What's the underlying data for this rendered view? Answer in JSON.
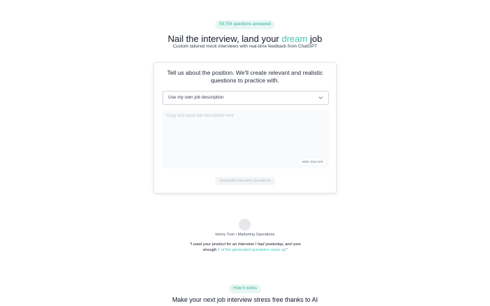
{
  "hero": {
    "badge": "59,754 questions answered",
    "title_part1": "Nail the interview, land your ",
    "title_accent": "dream",
    "title_part2": " job",
    "subtitle": "Custom tailored mock interviews with real-time feedback from ChatGPT"
  },
  "form": {
    "prompt": "Tell us about the position. We'll create relevant and realistic questions to practice with.",
    "select_value": "Use my own job description",
    "textarea_placeholder": "Copy and paste job description here",
    "char_count": "5000 chars left",
    "generate_label": "Generate Interview Questions"
  },
  "testimonial": {
    "author": "Henry Tran • Marketing Operations",
    "quote_part1": "\"I used your product for an interview I had yesterday, and sure enough ",
    "quote_accent": "1 of the generated questions came up",
    "quote_part2": "\""
  },
  "how_it_works": {
    "badge": "How it works",
    "title": "Make your next job interview stress free thanks to AI"
  },
  "colors": {
    "accent": "#44c6b3",
    "badge_bg": "#e7f7f3",
    "badge_text": "#2bb39a"
  }
}
